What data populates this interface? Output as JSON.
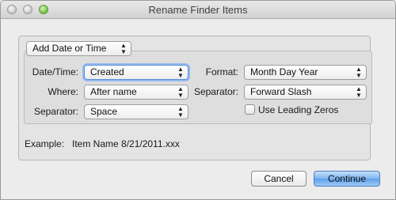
{
  "window": {
    "title": "Rename Finder Items"
  },
  "action_popup": {
    "value": "Add Date or Time"
  },
  "fields": {
    "date_time_label": "Date/Time:",
    "date_time_value": "Created",
    "where_label": "Where:",
    "where_value": "After name",
    "separator_left_label": "Separator:",
    "separator_left_value": "Space",
    "format_label": "Format:",
    "format_value": "Month Day Year",
    "separator_right_label": "Separator:",
    "separator_right_value": "Forward Slash",
    "leading_zeros_label": "Use Leading Zeros",
    "leading_zeros_checked": false
  },
  "example": {
    "label": "Example:",
    "value": "Item Name 8/21/2011.xxx"
  },
  "buttons": {
    "cancel": "Cancel",
    "continue": "Continue"
  },
  "icons": {
    "popup_arrows": "⇕"
  }
}
